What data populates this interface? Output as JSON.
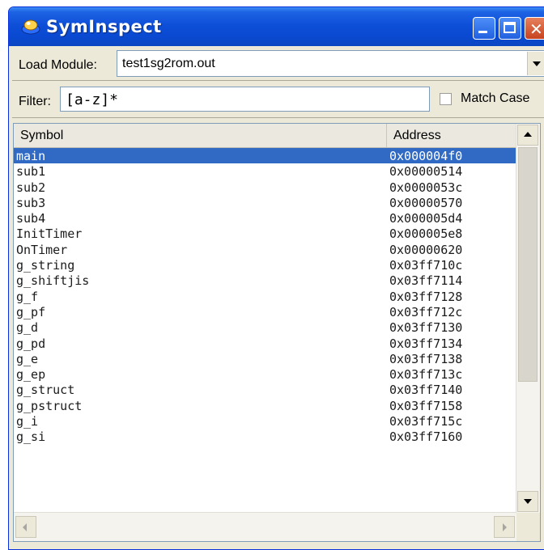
{
  "window": {
    "title": "SymInspect",
    "icon": "app-icon"
  },
  "load_module": {
    "label": "Load Module:",
    "value": "test1sg2rom.out"
  },
  "filter": {
    "label": "Filter:",
    "value": "[a-z]*"
  },
  "match_case": {
    "label": "Match Case",
    "checked": false
  },
  "table": {
    "columns": [
      "Symbol",
      "Address"
    ],
    "selected_index": 0,
    "rows": [
      {
        "symbol": "main",
        "address": "0x000004f0"
      },
      {
        "symbol": "sub1",
        "address": "0x00000514"
      },
      {
        "symbol": "sub2",
        "address": "0x0000053c"
      },
      {
        "symbol": "sub3",
        "address": "0x00000570"
      },
      {
        "symbol": "sub4",
        "address": "0x000005d4"
      },
      {
        "symbol": "InitTimer",
        "address": "0x000005e8"
      },
      {
        "symbol": "OnTimer",
        "address": "0x00000620"
      },
      {
        "symbol": "g_string",
        "address": "0x03ff710c"
      },
      {
        "symbol": "g_shiftjis",
        "address": "0x03ff7114"
      },
      {
        "symbol": "g_f",
        "address": "0x03ff7128"
      },
      {
        "symbol": "g_pf",
        "address": "0x03ff712c"
      },
      {
        "symbol": "g_d",
        "address": "0x03ff7130"
      },
      {
        "symbol": "g_pd",
        "address": "0x03ff7134"
      },
      {
        "symbol": "g_e",
        "address": "0x03ff7138"
      },
      {
        "symbol": "g_ep",
        "address": "0x03ff713c"
      },
      {
        "symbol": "g_struct",
        "address": "0x03ff7140"
      },
      {
        "symbol": "g_pstruct",
        "address": "0x03ff7158"
      },
      {
        "symbol": "g_i",
        "address": "0x03ff715c"
      },
      {
        "symbol": "g_si",
        "address": "0x03ff7160"
      }
    ]
  },
  "colors": {
    "selection": "#316ac5",
    "titlebar": "#0a49d1",
    "close_button": "#c7431f"
  }
}
